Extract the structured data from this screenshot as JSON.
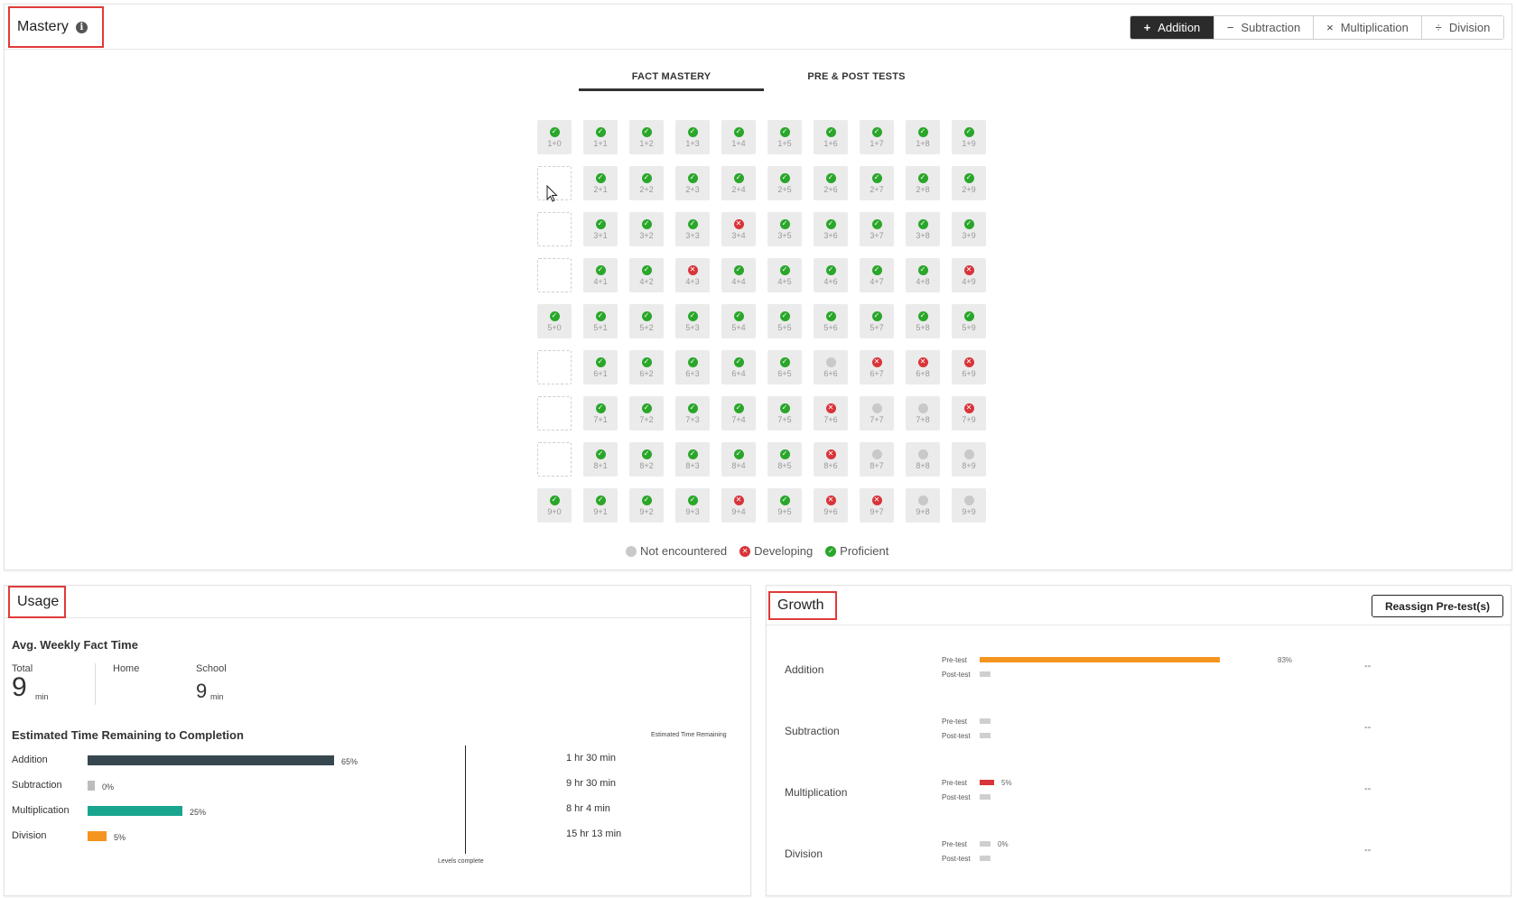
{
  "mastery": {
    "title": "Mastery",
    "info_icon": "info-icon",
    "operations": [
      {
        "symbol": "+",
        "label": "Addition",
        "active": true
      },
      {
        "symbol": "−",
        "label": "Subtraction",
        "active": false
      },
      {
        "symbol": "×",
        "label": "Multiplication",
        "active": false
      },
      {
        "symbol": "÷",
        "label": "Division",
        "active": false
      }
    ],
    "tabs": [
      {
        "label": "FACT MASTERY",
        "active": true
      },
      {
        "label": "PRE & POST TESTS",
        "active": false
      }
    ],
    "grid": [
      [
        {
          "f": "1+0",
          "s": "p"
        },
        {
          "f": "1+1",
          "s": "p"
        },
        {
          "f": "1+2",
          "s": "p"
        },
        {
          "f": "1+3",
          "s": "p"
        },
        {
          "f": "1+4",
          "s": "p"
        },
        {
          "f": "1+5",
          "s": "p"
        },
        {
          "f": "1+6",
          "s": "p"
        },
        {
          "f": "1+7",
          "s": "p"
        },
        {
          "f": "1+8",
          "s": "p"
        },
        {
          "f": "1+9",
          "s": "p"
        }
      ],
      [
        {
          "f": "",
          "s": "e"
        },
        {
          "f": "2+1",
          "s": "p"
        },
        {
          "f": "2+2",
          "s": "p"
        },
        {
          "f": "2+3",
          "s": "p"
        },
        {
          "f": "2+4",
          "s": "p"
        },
        {
          "f": "2+5",
          "s": "p"
        },
        {
          "f": "2+6",
          "s": "p"
        },
        {
          "f": "2+7",
          "s": "p"
        },
        {
          "f": "2+8",
          "s": "p"
        },
        {
          "f": "2+9",
          "s": "p"
        }
      ],
      [
        {
          "f": "",
          "s": "e"
        },
        {
          "f": "3+1",
          "s": "p"
        },
        {
          "f": "3+2",
          "s": "p"
        },
        {
          "f": "3+3",
          "s": "p"
        },
        {
          "f": "3+4",
          "s": "d"
        },
        {
          "f": "3+5",
          "s": "p"
        },
        {
          "f": "3+6",
          "s": "p"
        },
        {
          "f": "3+7",
          "s": "p"
        },
        {
          "f": "3+8",
          "s": "p"
        },
        {
          "f": "3+9",
          "s": "p"
        }
      ],
      [
        {
          "f": "",
          "s": "e"
        },
        {
          "f": "4+1",
          "s": "p"
        },
        {
          "f": "4+2",
          "s": "p"
        },
        {
          "f": "4+3",
          "s": "d"
        },
        {
          "f": "4+4",
          "s": "p"
        },
        {
          "f": "4+5",
          "s": "p"
        },
        {
          "f": "4+6",
          "s": "p"
        },
        {
          "f": "4+7",
          "s": "p"
        },
        {
          "f": "4+8",
          "s": "p"
        },
        {
          "f": "4+9",
          "s": "d"
        }
      ],
      [
        {
          "f": "5+0",
          "s": "p"
        },
        {
          "f": "5+1",
          "s": "p"
        },
        {
          "f": "5+2",
          "s": "p"
        },
        {
          "f": "5+3",
          "s": "p"
        },
        {
          "f": "5+4",
          "s": "p"
        },
        {
          "f": "5+5",
          "s": "p"
        },
        {
          "f": "5+6",
          "s": "p"
        },
        {
          "f": "5+7",
          "s": "p"
        },
        {
          "f": "5+8",
          "s": "p"
        },
        {
          "f": "5+9",
          "s": "p"
        }
      ],
      [
        {
          "f": "",
          "s": "e"
        },
        {
          "f": "6+1",
          "s": "p"
        },
        {
          "f": "6+2",
          "s": "p"
        },
        {
          "f": "6+3",
          "s": "p"
        },
        {
          "f": "6+4",
          "s": "p"
        },
        {
          "f": "6+5",
          "s": "p"
        },
        {
          "f": "6+6",
          "s": "n"
        },
        {
          "f": "6+7",
          "s": "d"
        },
        {
          "f": "6+8",
          "s": "d"
        },
        {
          "f": "6+9",
          "s": "d"
        }
      ],
      [
        {
          "f": "",
          "s": "e"
        },
        {
          "f": "7+1",
          "s": "p"
        },
        {
          "f": "7+2",
          "s": "p"
        },
        {
          "f": "7+3",
          "s": "p"
        },
        {
          "f": "7+4",
          "s": "p"
        },
        {
          "f": "7+5",
          "s": "p"
        },
        {
          "f": "7+6",
          "s": "d"
        },
        {
          "f": "7+7",
          "s": "n"
        },
        {
          "f": "7+8",
          "s": "n"
        },
        {
          "f": "7+9",
          "s": "d"
        }
      ],
      [
        {
          "f": "",
          "s": "e"
        },
        {
          "f": "8+1",
          "s": "p"
        },
        {
          "f": "8+2",
          "s": "p"
        },
        {
          "f": "8+3",
          "s": "p"
        },
        {
          "f": "8+4",
          "s": "p"
        },
        {
          "f": "8+5",
          "s": "p"
        },
        {
          "f": "8+6",
          "s": "d"
        },
        {
          "f": "8+7",
          "s": "n"
        },
        {
          "f": "8+8",
          "s": "n"
        },
        {
          "f": "8+9",
          "s": "n"
        }
      ],
      [
        {
          "f": "9+0",
          "s": "p"
        },
        {
          "f": "9+1",
          "s": "p"
        },
        {
          "f": "9+2",
          "s": "p"
        },
        {
          "f": "9+3",
          "s": "p"
        },
        {
          "f": "9+4",
          "s": "d"
        },
        {
          "f": "9+5",
          "s": "p"
        },
        {
          "f": "9+6",
          "s": "d"
        },
        {
          "f": "9+7",
          "s": "d"
        },
        {
          "f": "9+8",
          "s": "n"
        },
        {
          "f": "9+9",
          "s": "n"
        }
      ]
    ],
    "legend": [
      {
        "label": "Not encountered",
        "status": "n"
      },
      {
        "label": "Developing",
        "status": "d"
      },
      {
        "label": "Proficient",
        "status": "p"
      }
    ],
    "colors": {
      "proficient": "#2aa62a",
      "developing": "#d9343a",
      "not_encountered": "#c9c9c9"
    }
  },
  "usage": {
    "title": "Usage",
    "avg_title": "Avg. Weekly Fact Time",
    "total_label": "Total",
    "total_value": "9",
    "total_unit": "min",
    "home_label": "Home",
    "school_label": "School",
    "school_value": "9",
    "school_unit": "min",
    "etr_title": "Estimated Time Remaining to Completion",
    "etr_header": "Estimated Time Remaining",
    "levels_label": "Levels complete",
    "rows": [
      {
        "label": "Addition",
        "pct_label": "65%",
        "pct": 65,
        "color": "#37474f",
        "time": "1 hr 30 min"
      },
      {
        "label": "Subtraction",
        "pct_label": "0%",
        "pct": 0,
        "color": "#bdbdbd",
        "time": "9 hr 30 min"
      },
      {
        "label": "Multiplication",
        "pct_label": "25%",
        "pct": 25,
        "color": "#1aa590",
        "time": "8 hr 4 min"
      },
      {
        "label": "Division",
        "pct_label": "5%",
        "pct": 5,
        "color": "#f5941e",
        "time": "15 hr 13 min"
      }
    ]
  },
  "growth": {
    "title": "Growth",
    "reassign_label": "Reassign Pre-test(s)",
    "pre_label": "Pre-test",
    "post_label": "Post-test",
    "rows": [
      {
        "label": "Addition",
        "pre_pct": 83,
        "pre_label": "83%",
        "pre_color": "#f5941e",
        "post_pct": 0,
        "dash": "--"
      },
      {
        "label": "Subtraction",
        "pre_pct": 0,
        "pre_label": "",
        "pre_color": "#cfcfcf",
        "post_pct": 0,
        "dash": "--"
      },
      {
        "label": "Multiplication",
        "pre_pct": 5,
        "pre_label": "5%",
        "pre_color": "#d9343a",
        "post_pct": 0,
        "dash": "--"
      },
      {
        "label": "Division",
        "pre_pct": 0,
        "pre_label": "0%",
        "pre_color": "#cfcfcf",
        "post_pct": 0,
        "dash": "--"
      }
    ]
  }
}
